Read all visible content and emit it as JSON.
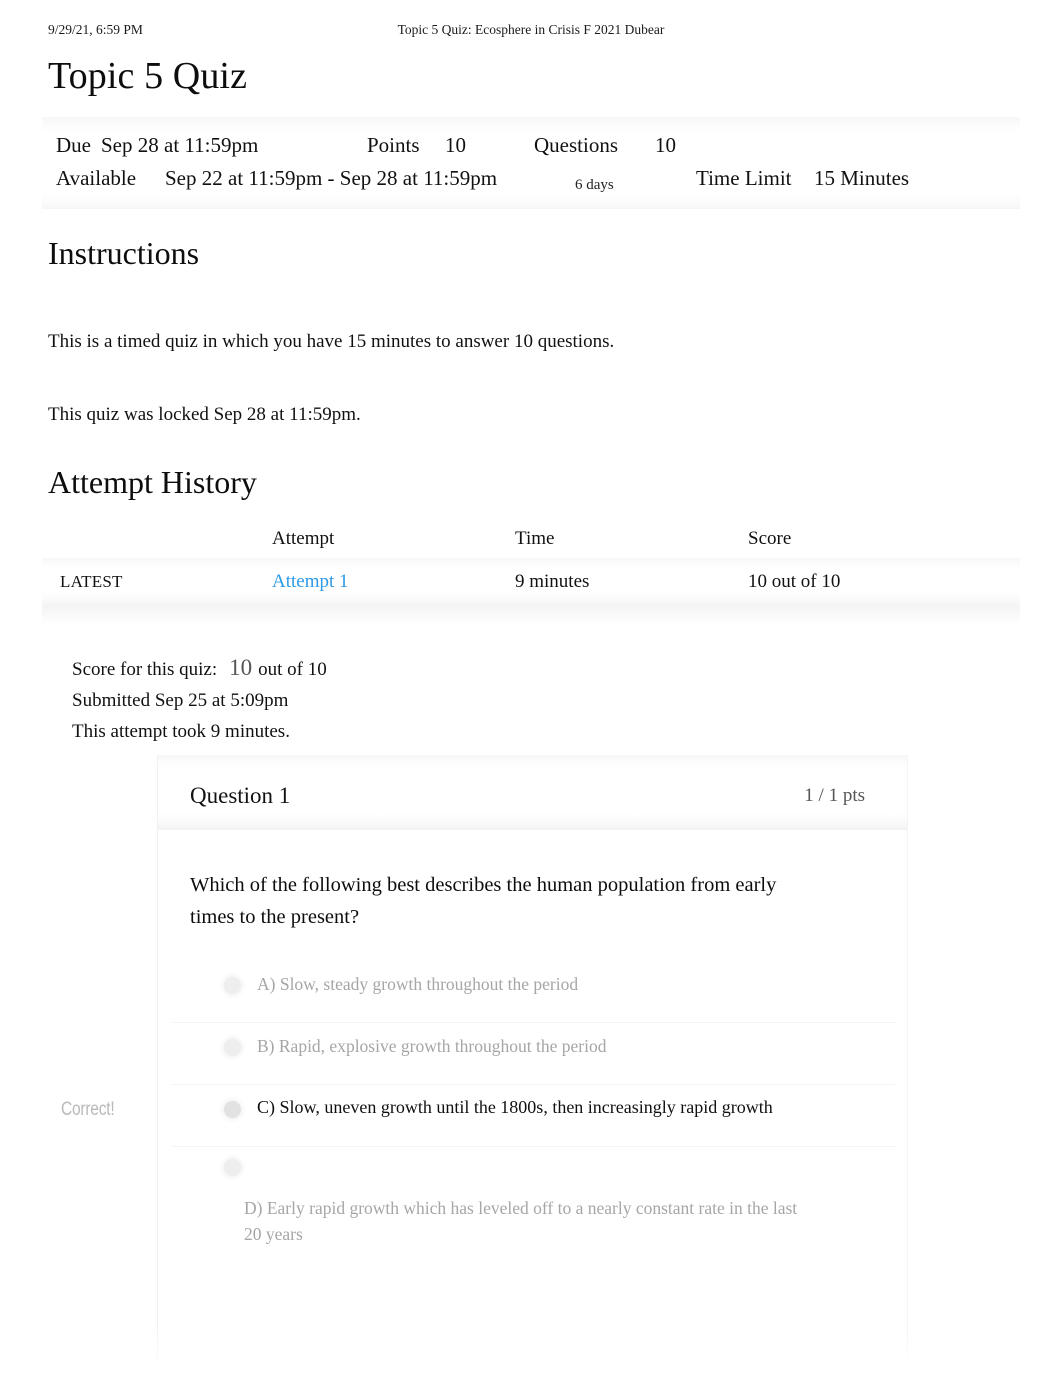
{
  "print_header": {
    "date": "9/29/21, 6:59 PM",
    "document_title": "Topic 5 Quiz: Ecosphere in Crisis F 2021 Dubear"
  },
  "page_title": "Topic 5 Quiz",
  "quiz_info": {
    "due_label": "Due",
    "due_value": "Sep 28 at 11:59pm",
    "points_label": "Points",
    "points_value": "10",
    "questions_label": "Questions",
    "questions_value": "10",
    "available_label": "Available",
    "available_value": "Sep 22 at 11:59pm - Sep 28 at 11:59pm",
    "available_duration": "6 days",
    "time_limit_label": "Time Limit",
    "time_limit_value": "15 Minutes"
  },
  "instructions": {
    "heading": "Instructions",
    "paragraph_1": "This is a timed quiz in which you have 15 minutes to answer 10 questions.",
    "paragraph_2": "This quiz was locked Sep 28 at 11:59pm."
  },
  "attempt_history": {
    "heading": "Attempt History",
    "columns": [
      "",
      "Attempt",
      "Time",
      "Score"
    ],
    "rows": [
      {
        "kept": "LATEST",
        "attempt": "Attempt 1",
        "time": "9 minutes",
        "score": "10 out of 10"
      }
    ]
  },
  "score_summary": {
    "score_label": "Score for this quiz:",
    "score_value": "10",
    "score_out_of": "out of 10",
    "submitted": "Submitted Sep 25 at 5:09pm",
    "duration": "This attempt took 9 minutes."
  },
  "question": {
    "title": "Question 1",
    "points": "1 / 1 pts",
    "text": "Which of the following best describes the human population from early times to the present?",
    "correct_marker": "Correct!",
    "answers": [
      {
        "label": "A) Slow, steady growth throughout the period",
        "selected": false
      },
      {
        "label": "B) Rapid, explosive growth throughout the period",
        "selected": false
      },
      {
        "label": "C) Slow, uneven growth until the 1800s, then increasingly rapid growth",
        "selected": true
      },
      {
        "label": "D) Early rapid growth which has leveled off to a nearly constant rate in the last 20 years",
        "selected": false
      }
    ]
  },
  "colors": {
    "link": "#2c9ae8",
    "text": "#111111",
    "muted": "#a6a6a6",
    "marker": "#b9b9b9"
  }
}
